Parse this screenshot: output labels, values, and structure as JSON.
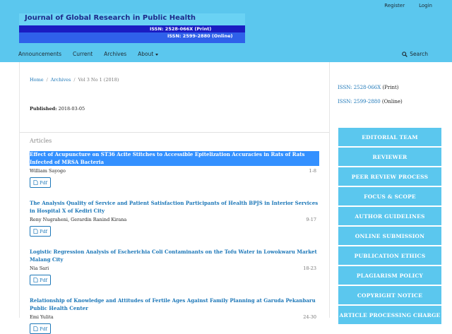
{
  "header": {
    "user_nav": [
      "Register",
      "Login"
    ],
    "banner": {
      "title": "Journal of Global Research in Public Health",
      "issn_print": "ISSN: 2528-066X (Print)",
      "issn_online": "ISSN: 2599-2880 (Online)"
    },
    "nav": [
      "Announcements",
      "Current",
      "Archives",
      "About"
    ],
    "search_label": "Search"
  },
  "breadcrumb": {
    "home": "Home",
    "archives": "Archives",
    "current": "Vol 3 No 1 (2018)"
  },
  "published": {
    "label": "Published:",
    "date": "2018-03-05"
  },
  "articles_heading": "Articles",
  "articles": [
    {
      "title": "Effect of Acupuncture on ST36 Acite Stitches to Accessible Epitelization Accuracies in Rats of Rats Infected of MRSA Bacteria",
      "authors": "William Sayogo",
      "pages": "1-8",
      "pdf": "Pdf"
    },
    {
      "title": "The Analysis Quality of Service and Patient Satisfaction Participants of Health BPJS in Interior Services in Hospital X of Kediri City",
      "authors": "Reny Nugraheni, Gerardin Ranind Kirana",
      "pages": "9-17",
      "pdf": "Pdf"
    },
    {
      "title": "Logistic Regression Analysis of Escherichia Coli Contaminants on the Tofu Water in Lowokwaru Market Malang City",
      "authors": "Nia Sari",
      "pages": "18-23",
      "pdf": "Pdf"
    },
    {
      "title": "Relationship of Knowledge and Attitudes of Fertile Ages Against Family Planning at Garuda Pekanbaru Public Health Center",
      "authors": "Emi Yulita",
      "pages": "24-30",
      "pdf": "Pdf"
    }
  ],
  "sidebar": {
    "issn_print": {
      "number": "ISSN: 2528-066X",
      "suffix": "(Print)"
    },
    "issn_online": {
      "number": "ISSN: 2599-2880",
      "suffix": "(Online)"
    },
    "menu": [
      "EDITORIAL TEAM",
      "REVIEWER",
      "PEER REVIEW PROCESS",
      "FOCUS & SCOPE",
      "AUTHOR GUIDELINES",
      "ONLINE SUBMISSION",
      "PUBLICATION ETHICS",
      "PLAGIARISM POLICY",
      "COPYRIGHT NOTICE",
      "ARTICLE PROCESSING CHARGE"
    ]
  },
  "colors": {
    "header_bg": "#5bc7ee",
    "link": "#1c77b8",
    "selection": "#3390ff",
    "sidebar_button": "#5bc7ee"
  },
  "icons": [
    "search-icon",
    "pdf-icon",
    "caret-down-icon"
  ]
}
